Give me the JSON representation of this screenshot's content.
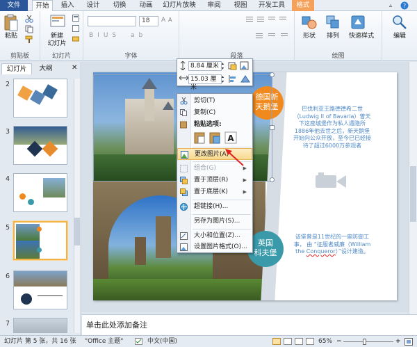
{
  "tabs": [
    "文件",
    "开始",
    "插入",
    "设计",
    "切换",
    "动画",
    "幻灯片放映",
    "审阅",
    "视图",
    "开发工具",
    "格式"
  ],
  "ribbon": {
    "groups": [
      "剪贴板",
      "幻灯片",
      "字体",
      "段落",
      "绘图"
    ],
    "paste_label": "粘贴",
    "new_slide_label": "新建\n幻灯片",
    "font_size": "18",
    "shape_label": "形状",
    "arrange_label": "排列",
    "quick_style_label": "快速样式",
    "edit_label": "编辑"
  },
  "left_panel": {
    "tabs": [
      "幻灯片",
      "大纲"
    ],
    "slide_numbers": [
      "2",
      "3",
      "4",
      "5",
      "6",
      "7"
    ],
    "selected": "5"
  },
  "slide": {
    "badge1": "德国新\n天鹅堡",
    "badge2": "英国\n科夫堡",
    "text1": "巴伐利亚王路德德希二世（Ludwig II of Bavaria）曾天下这座城堡作为私人遁隐所1886年他去世之后，新天鹅堡开始向公众开放，至今已已经接待了超过6000万参观者",
    "text2_pre": "该堡曾是11世纪的一座防御工事， 由 “征服者威廉（William the ",
    "text2_link": "Conqueror",
    "text2_post": "）”设计建造。",
    "colors": {
      "orange": "#f18a1e",
      "teal": "#3a9aaa",
      "text": "#4f8ac9"
    }
  },
  "mini_toolbar": {
    "height": "8.84 厘米",
    "width": "15.03 厘米"
  },
  "context_menu": {
    "cut": "剪切(T)",
    "copy": "复制(C)",
    "paste_options": "粘贴选项:",
    "change_picture": "更改图片(A)",
    "group": "组合(G)",
    "bring_front": "置于顶层(R)",
    "send_back": "置于底层(K)",
    "hyperlink": "超链接(H)...",
    "save_as_picture": "另存为图片(S)...",
    "size_position": "大小和位置(Z)...",
    "format_picture": "设置图片格式(O)..."
  },
  "notes_placeholder": "单击此处添加备注",
  "status": {
    "slide_info": "幻灯片 第 5 张，共 16 张",
    "theme": "\"Office 主题\"",
    "language": "中文(中国)",
    "zoom": "65%"
  }
}
